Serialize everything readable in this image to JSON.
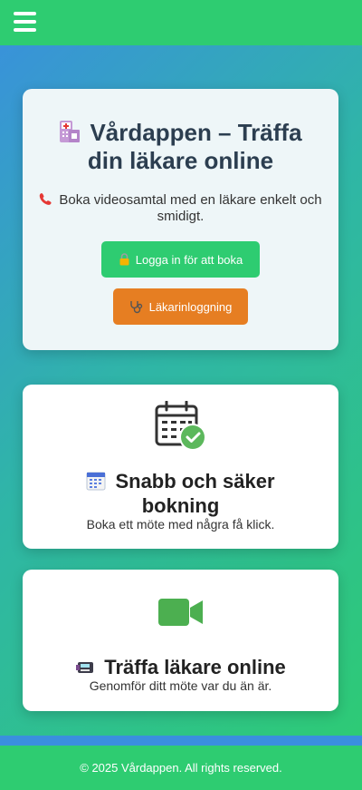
{
  "header": {
    "menu_icon": "hamburger-menu-icon",
    "color": "#2ecc71"
  },
  "hero": {
    "title": "Vårdappen – Träffa din läkare online",
    "subtitle": "Boka videosamtal med en läkare enkelt och smidigt.",
    "login_button": "Logga in för att boka",
    "doctor_button": "Läkarinloggning",
    "title_icon": "hospital-emoji-icon",
    "subtitle_icon": "telephone-receiver-icon",
    "login_icon": "lock-icon",
    "doctor_icon": "stethoscope-icon"
  },
  "features": [
    {
      "icon": "calendar-check-icon",
      "title_icon": "calendar-emoji-icon",
      "title": "Snabb och säker bokning",
      "desc": "Boka ett möte med några få klick."
    },
    {
      "icon": "video-camera-icon",
      "title_icon": "pager-emoji-icon",
      "title": "Träffa läkare online",
      "desc": "Genomför ditt möte var du än är."
    }
  ],
  "footer": {
    "text": "© 2025 Vårdappen. All rights reserved."
  },
  "colors": {
    "primary": "#2ecc71",
    "accent": "#e67e22",
    "blue": "#3a8fde",
    "text": "#2c3e50"
  }
}
